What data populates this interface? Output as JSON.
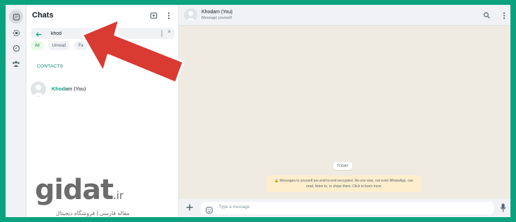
{
  "sidebar": {
    "title": "Chats",
    "search": {
      "value": "khod",
      "clear_label": "×"
    },
    "filters": [
      {
        "label": "All",
        "active": true
      },
      {
        "label": "Unread",
        "active": false
      },
      {
        "label": "Fa",
        "active": false
      }
    ],
    "contacts_header": "CONTACTS",
    "contacts": [
      {
        "name_match": "Khod",
        "name_rest": "am (You)"
      }
    ]
  },
  "chat": {
    "header": {
      "name": "Khodam (You)",
      "subtitle": "Message yourself"
    },
    "date_badge": "TODAY",
    "encryption_notice": "🔒 Messages to yourself are end-to-end encrypted. No one else, not even WhatsApp, can read, listen to, or share them. Click to learn more",
    "compose": {
      "placeholder": "Type a message"
    }
  },
  "watermark": {
    "logo": "gidat",
    "tld": ".ir",
    "tagline": "مقاله فارسی | فروشگاه دیجیتال"
  },
  "colors": {
    "frame_border": "#0ba37f",
    "accent_green": "#008069",
    "arrow_red": "#d93a32"
  },
  "icons": [
    "chats-icon",
    "status-icon",
    "channels-icon",
    "communities-icon",
    "new-chat-icon",
    "menu-icon",
    "back-arrow-icon",
    "search-icon",
    "plus-icon",
    "sticker-icon",
    "mic-icon"
  ]
}
